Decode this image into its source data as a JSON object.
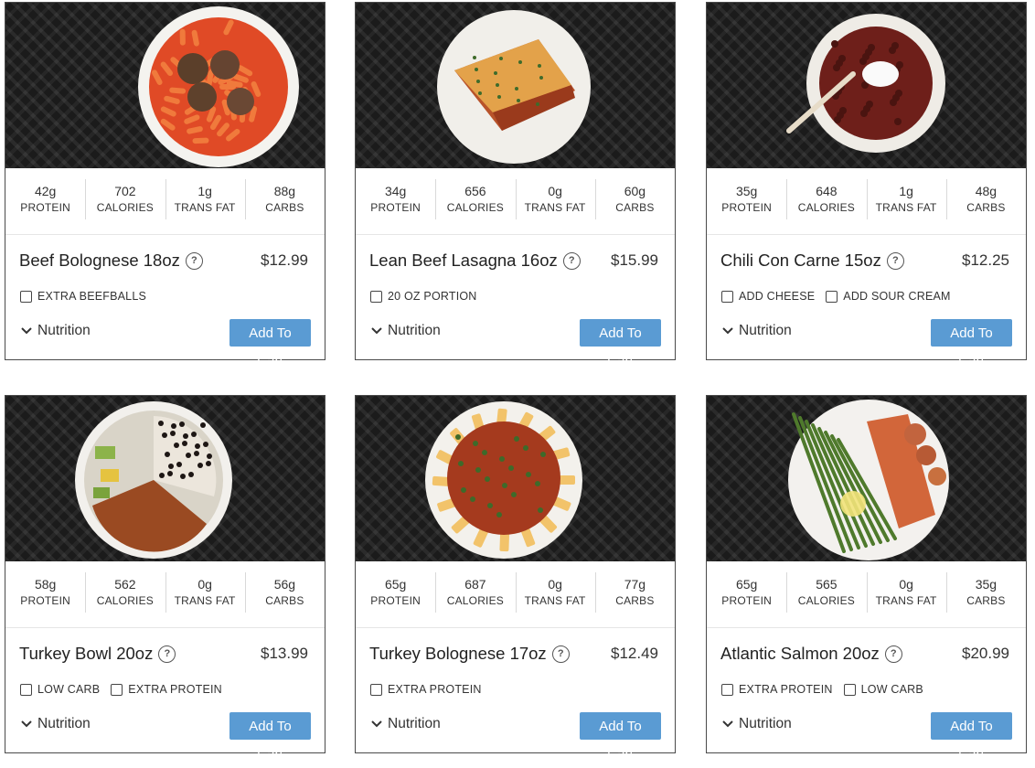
{
  "macro_labels": {
    "protein": "PROTEIN",
    "calories": "CALORIES",
    "trans_fat": "TRANS FAT",
    "carbs": "CARBS"
  },
  "nutrition_label": "Nutrition",
  "cart_label": "Add To Cart",
  "help_glyph": "?",
  "products": [
    {
      "name": "Beef Bolognese 18oz",
      "price": "$12.99",
      "protein": "42g",
      "calories": "702",
      "trans_fat": "1g",
      "carbs": "88g",
      "options": [
        "EXTRA BEEFBALLS"
      ],
      "image": "pasta-with-meatballs"
    },
    {
      "name": "Lean Beef Lasagna 16oz",
      "price": "$15.99",
      "protein": "34g",
      "calories": "656",
      "trans_fat": "0g",
      "carbs": "60g",
      "options": [
        "20 OZ PORTION"
      ],
      "image": "lasagna"
    },
    {
      "name": "Chili Con Carne 15oz",
      "price": "$12.25",
      "protein": "35g",
      "calories": "648",
      "trans_fat": "1g",
      "carbs": "48g",
      "options": [
        "ADD CHEESE",
        "ADD SOUR CREAM"
      ],
      "image": "chili-bowl"
    },
    {
      "name": "Turkey Bowl 20oz",
      "price": "$13.99",
      "protein": "58g",
      "calories": "562",
      "trans_fat": "0g",
      "carbs": "56g",
      "options": [
        "LOW CARB",
        "EXTRA PROTEIN"
      ],
      "image": "turkey-rice-bowl"
    },
    {
      "name": "Turkey Bolognese 17oz",
      "price": "$12.49",
      "protein": "65g",
      "calories": "687",
      "trans_fat": "0g",
      "carbs": "77g",
      "options": [
        "EXTRA PROTEIN"
      ],
      "image": "rigatoni-bolognese"
    },
    {
      "name": "Atlantic Salmon 20oz",
      "price": "$20.99",
      "protein": "65g",
      "calories": "565",
      "trans_fat": "0g",
      "carbs": "35g",
      "options": [
        "EXTRA PROTEIN",
        "LOW CARB"
      ],
      "image": "salmon-asparagus"
    }
  ]
}
